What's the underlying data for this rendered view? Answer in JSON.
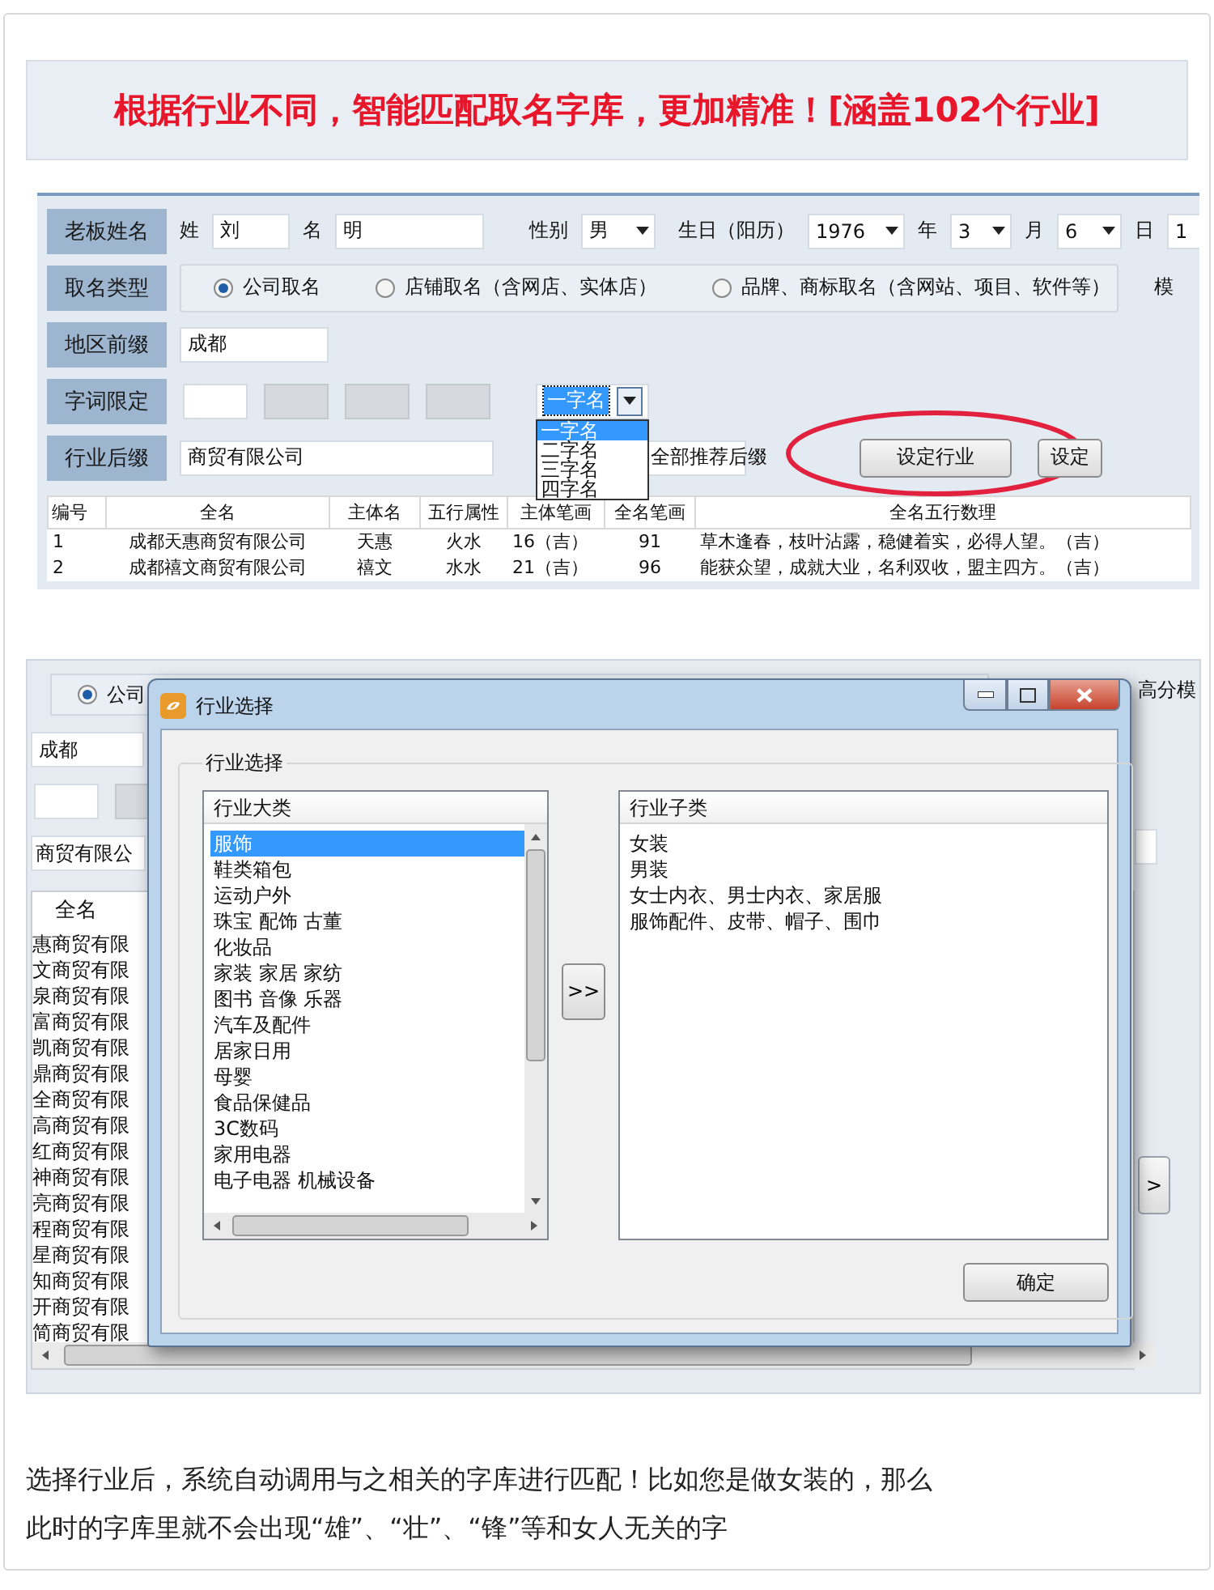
{
  "banner": {
    "text": "根据行业不同，智能匹配取名字库，更加精准！[涵盖102个行业]"
  },
  "form": {
    "boss": {
      "label": "老板姓名",
      "surname_label": "姓",
      "surname": "刘",
      "given_label": "名",
      "given": "明",
      "gender_label": "性别",
      "gender": "男",
      "birthday_label": "生日（阳历）",
      "year": "1976",
      "year_label": "年",
      "month": "3",
      "month_label": "月",
      "day": "6",
      "day_label": "日",
      "hour": "1"
    },
    "name_type": {
      "label": "取名类型",
      "trailing": "模",
      "options": [
        {
          "label": "公司取名",
          "selected": true
        },
        {
          "label": "店铺取名（含网店、实体店）",
          "selected": false
        },
        {
          "label": "品牌、商标取名（含网站、项目、软件等）",
          "selected": false
        }
      ]
    },
    "region": {
      "label": "地区前缀",
      "value": "成都"
    },
    "word_limit": {
      "label": "字词限定",
      "boxes": [
        {
          "disabled": false
        },
        {
          "disabled": true
        },
        {
          "disabled": true
        },
        {
          "disabled": true
        }
      ],
      "select": {
        "value": "一字名",
        "expanded": true,
        "options": [
          {
            "label": "一字名",
            "selected": true
          },
          {
            "label": "二字名",
            "selected": false
          },
          {
            "label": "三字名",
            "selected": false
          },
          {
            "label": "四字名",
            "selected": false
          }
        ]
      }
    },
    "suffix": {
      "label": "行业后缀",
      "value": "商贸有限公司",
      "select": "全部推荐后缀",
      "buttons": [
        {
          "label": "设定行业",
          "circled": true
        },
        {
          "label": "设定",
          "circled": false
        }
      ]
    },
    "table": {
      "columns": [
        "编号",
        "全名",
        "主体名",
        "五行属性",
        "主体笔画",
        "全名笔画",
        "全名五行数理"
      ],
      "rows": [
        [
          "1",
          "成都天惠商贸有限公司",
          "天惠",
          "火水",
          "16（吉）",
          "91",
          "草木逢春，枝叶沾露，稳健着实，必得人望。（吉）"
        ],
        [
          "2",
          "成都禧文商贸有限公司",
          "禧文",
          "水水",
          "21（吉）",
          "96",
          "能获众望，成就大业，名利双收，盟主四方。（吉）"
        ]
      ]
    }
  },
  "background_app": {
    "radio": {
      "label": "公司",
      "selected": true
    },
    "trailing": "高分模",
    "region": "成都",
    "suffix": "商贸有限公",
    "column": "全名",
    "names": [
      "惠商贸有限",
      "文商贸有限",
      "泉商贸有限",
      "富商贸有限",
      "凯商贸有限",
      "鼎商贸有限",
      "全商贸有限",
      "高商贸有限",
      "红商贸有限",
      "神商贸有限",
      "亮商贸有限",
      "程商贸有限",
      "星商贸有限",
      "知商贸有限",
      "开商贸有限",
      "简商贸有限"
    ],
    "next_button": ">"
  },
  "dialog": {
    "title": "行业选择",
    "group": "行业选择",
    "categories": {
      "header": "行业大类",
      "items": [
        {
          "label": "服饰",
          "selected": true
        },
        {
          "label": "鞋类箱包",
          "selected": false
        },
        {
          "label": "运动户外",
          "selected": false
        },
        {
          "label": "珠宝 配饰 古董",
          "selected": false
        },
        {
          "label": "化妆品",
          "selected": false
        },
        {
          "label": "家装 家居 家纺",
          "selected": false
        },
        {
          "label": "图书 音像 乐器",
          "selected": false
        },
        {
          "label": "汽车及配件",
          "selected": false
        },
        {
          "label": "居家日用",
          "selected": false
        },
        {
          "label": "母婴",
          "selected": false
        },
        {
          "label": "食品保健品",
          "selected": false
        },
        {
          "label": "3C数码",
          "selected": false
        },
        {
          "label": "家用电器",
          "selected": false
        },
        {
          "label": "电子电器 机械设备",
          "selected": false
        }
      ]
    },
    "move_button": ">>",
    "subcategories": {
      "header": "行业子类",
      "items": [
        "女装",
        "男装",
        "女士内衣、男士内衣、家居服",
        "服饰配件、皮带、帽子、围巾"
      ]
    },
    "ok_button": "确定"
  },
  "caption": {
    "lines": [
      "选择行业后，系统自动调用与之相关的字库进行匹配！比如您是做女装的，那么",
      "此时的字库里就不会出现“雄”、“壮”、“锋”等和女人无关的字"
    ]
  }
}
